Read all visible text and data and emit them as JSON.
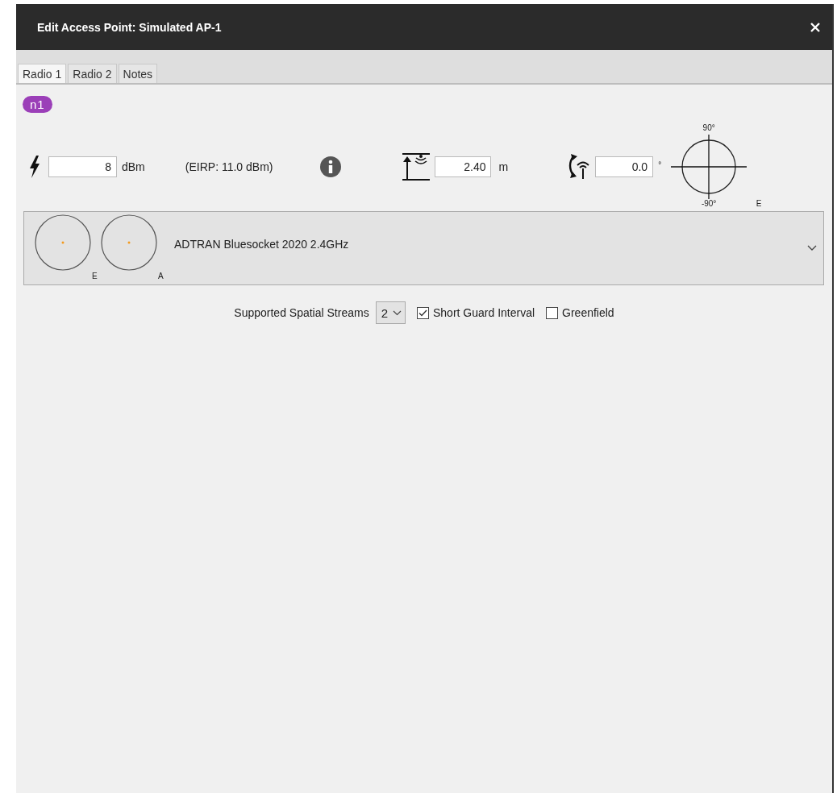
{
  "window": {
    "title": "Edit Access Point: Simulated AP-1"
  },
  "tabs": [
    {
      "label": "Radio 1",
      "selected": true
    },
    {
      "label": "Radio 2",
      "selected": false
    },
    {
      "label": "Notes",
      "selected": false
    }
  ],
  "badge": "n1",
  "power": {
    "value": "8",
    "unit": "dBm",
    "eirp": "(EIRP: 11.0 dBm)"
  },
  "height": {
    "value": "2.40",
    "unit": "m"
  },
  "tilt": {
    "value": "0.0",
    "unit": "°",
    "top_label": "90°",
    "bottom_label": "-90°",
    "plane_label": "E"
  },
  "antenna": {
    "name": "ADTRAN Bluesocket 2020 2.4GHz",
    "patterns": [
      "E",
      "A"
    ]
  },
  "options": {
    "streams_label": "Supported Spatial Streams",
    "streams_value": "2",
    "checkboxes": [
      {
        "label": "Short Guard Interval",
        "checked": true
      },
      {
        "label": "Greenfield",
        "checked": false
      }
    ]
  }
}
